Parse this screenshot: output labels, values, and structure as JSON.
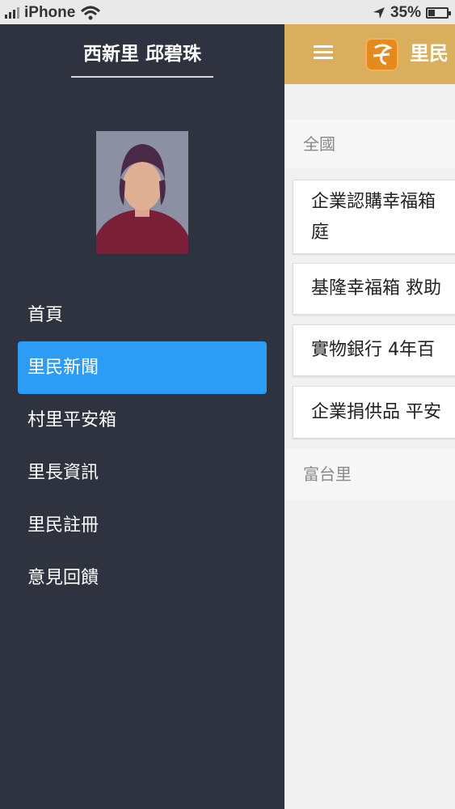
{
  "status_bar": {
    "carrier": "iPhone",
    "battery_percent": "35%",
    "battery_level": 0.35
  },
  "drawer": {
    "header": "西新里 邱碧珠",
    "menu": [
      {
        "label": "首頁",
        "active": false
      },
      {
        "label": "里民新聞",
        "active": true
      },
      {
        "label": "村里平安箱",
        "active": false
      },
      {
        "label": "里長資訊",
        "active": false
      },
      {
        "label": "里民註冊",
        "active": false
      },
      {
        "label": "意見回饋",
        "active": false
      }
    ]
  },
  "app_bar": {
    "title": "里民"
  },
  "sections": [
    {
      "label": "全國",
      "items": [
        {
          "line1": "企業認購幸福箱",
          "line2": "庭"
        },
        {
          "line1": "基隆幸福箱 救助"
        },
        {
          "line1": "實物銀行 4年百"
        },
        {
          "line1": "企業捐供品 平安"
        }
      ]
    },
    {
      "label": "富台里",
      "items": []
    }
  ],
  "colors": {
    "drawer_bg": "#2f3340",
    "active_item": "#2d9cf4",
    "app_bar": "#d9ae5d",
    "app_logo": "#e58a1f"
  }
}
